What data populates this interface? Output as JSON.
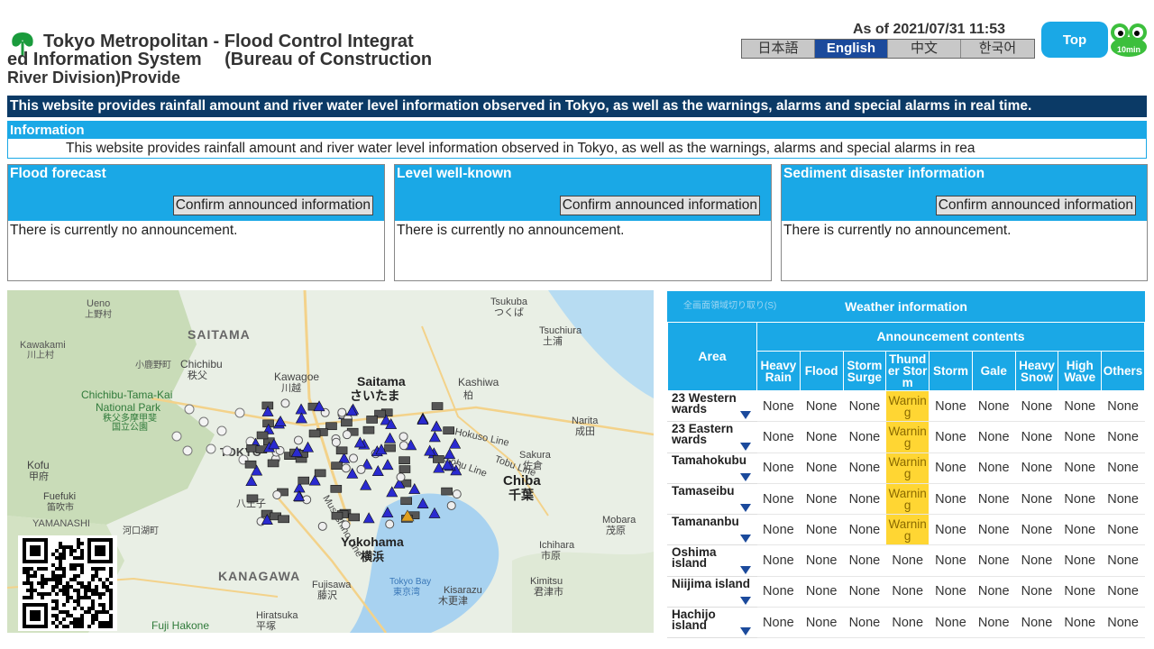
{
  "header": {
    "title_line1": "Tokyo Metropolitan - Flood Control Integrat",
    "title_line2": "ed Information System　 (Bureau of Construction",
    "title_line3": "River Division)Provide",
    "as_of": "As of 2021/07/31 11:53",
    "languages": [
      "日本語",
      "English",
      "中文",
      "한국어"
    ],
    "active_language": "English",
    "top_button": "Top",
    "mascot_text": "10min"
  },
  "banner": "This website provides rainfall amount and river water level information observed in Tokyo, as well as the warnings, alarms and special alarms in real time.",
  "information": {
    "heading": "Information",
    "text": "This website provides rainfall amount and river water level information observed in Tokyo, as well as the warnings, alarms and special alarms in rea"
  },
  "panels": [
    {
      "title": "Flood forecast",
      "button": "Confirm announced information",
      "body": "There is currently no announcement."
    },
    {
      "title": "Level well-known",
      "button": "Confirm announced information",
      "body": "There is currently no announcement."
    },
    {
      "title": "Sediment disaster information",
      "button": "Confirm announced information",
      "body": "There is currently no announcement."
    }
  ],
  "map": {
    "labels": [
      "Ueno",
      "上野村",
      "SAITAMA",
      "Kawakami",
      "川上村",
      "Chichibu",
      "秩父",
      "小鹿野町",
      "Chichibu-Tama-Kai",
      "National Park",
      "秩父多摩甲斐",
      "国立公園",
      "Kawagoe",
      "川越",
      "Saitama",
      "さいたま",
      "Tsukuba",
      "つくば",
      "Tsuchiura",
      "土浦",
      "Kashiwa",
      "柏",
      "Narita",
      "成田",
      "Sakura",
      "佐倉",
      "Chiba",
      "千葉",
      "Kofu",
      "甲府",
      "Fuefuki",
      "笛吹市",
      "八王子",
      "Yokohama",
      "横浜",
      "KANAGAWA",
      "Fujisawa",
      "藤沢",
      "Hiratsuka",
      "平塚",
      "Fuji Hakone",
      "Tokyo Bay",
      "東京湾",
      "Kisarazu",
      "木更津",
      "Ichihara",
      "市原",
      "Kimitsu",
      "君津市",
      "Mobara",
      "茂原",
      "Hokuso Line",
      "Sobu Line",
      "Tobu Line",
      "Musashino Line",
      "Yamanashi",
      "YAMANASHI",
      "河口湖町",
      "TOKYO"
    ],
    "qr": "qr-code"
  },
  "weather": {
    "ghost_text": "全画面領域切り取り(S)",
    "title": "Weather information",
    "area_header": "Area",
    "announcement_header": "Announcement contents",
    "columns": [
      "Heavy Rain",
      "Flood",
      "Storm Surge",
      "Thunder Storm",
      "Storm",
      "Gale",
      "Heavy Snow",
      "High Wave",
      "Others"
    ],
    "rows": [
      {
        "area": "23 Western wards",
        "values": [
          "None",
          "None",
          "None",
          "Warning",
          "None",
          "None",
          "None",
          "None",
          "None"
        ]
      },
      {
        "area": "23 Eastern wards",
        "values": [
          "None",
          "None",
          "None",
          "Warning",
          "None",
          "None",
          "None",
          "None",
          "None"
        ]
      },
      {
        "area": "Tamahokubu",
        "values": [
          "None",
          "None",
          "None",
          "Warning",
          "None",
          "None",
          "None",
          "None",
          "None"
        ]
      },
      {
        "area": "Tamaseibu",
        "values": [
          "None",
          "None",
          "None",
          "Warning",
          "None",
          "None",
          "None",
          "None",
          "None"
        ]
      },
      {
        "area": "Tamananbu",
        "values": [
          "None",
          "None",
          "None",
          "Warning",
          "None",
          "None",
          "None",
          "None",
          "None"
        ]
      },
      {
        "area": "Oshima island",
        "values": [
          "None",
          "None",
          "None",
          "None",
          "None",
          "None",
          "None",
          "None",
          "None"
        ]
      },
      {
        "area": "Niijima island",
        "values": [
          "None",
          "None",
          "None",
          "None",
          "None",
          "None",
          "None",
          "None",
          "None"
        ]
      },
      {
        "area": "Hachijo island",
        "values": [
          "None",
          "None",
          "None",
          "None",
          "None",
          "None",
          "None",
          "None",
          "None"
        ]
      }
    ],
    "colors": {
      "header": "#1aa8e6",
      "warning": "#ffd633"
    }
  }
}
